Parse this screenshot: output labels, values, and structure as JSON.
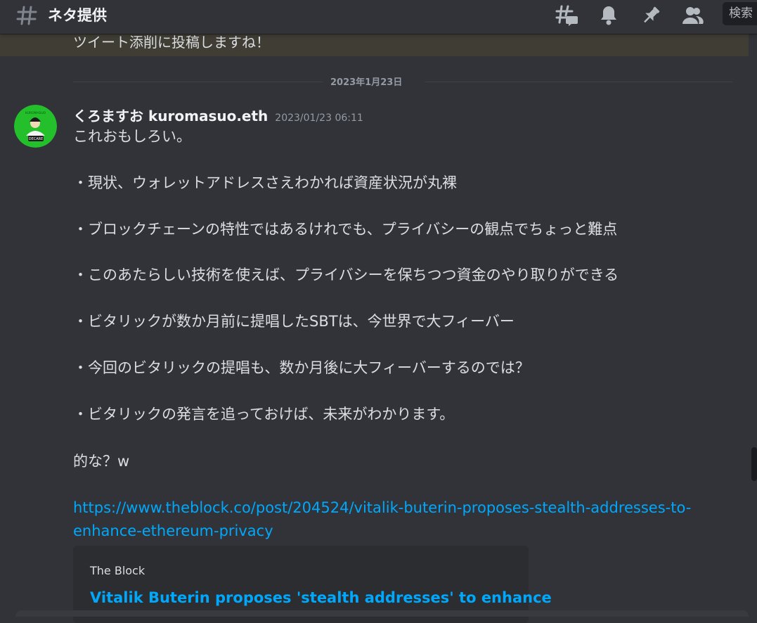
{
  "header": {
    "channel_icon": "hash-icon",
    "channel_name": "ネタ提供",
    "icons": [
      "threads-icon",
      "bell-icon",
      "pin-icon",
      "members-icon"
    ],
    "search_placeholder": "検索"
  },
  "previous_message": {
    "text": "ツイート添削に投稿しますね！",
    "highlight_color": "#403d35"
  },
  "date_divider": "2023年1月23日",
  "message": {
    "avatar_icon": "avatar-image",
    "author": "くろますお kuromasuo.eth",
    "timestamp": "2023/01/23 06:11",
    "lines": [
      "これおもしろい。",
      "・現状、ウォレットアドレスさえわかれば資産状況が丸裸",
      "・ブロックチェーンの特性ではあるけれでも、プライバシーの観点でちょっと難点",
      "・このあたらしい技術を使えば、プライバシーを保ちつつ資金のやり取りができる",
      "・ビタリックが数か月前に提唱したSBTは、今世界で大フィーバー",
      "・今回のビタリックの提唱も、数か月後に大フィーバーするのでは？",
      "・ビタリックの発言を追っておけば、未来がわかります。",
      "的な？w"
    ],
    "link_lines": [
      "https://www.theblock.co/post/204524/vitalik-buterin-proposes-stealth-addresses-to-",
      "enhance-ethereum-privacy"
    ],
    "link_color": "#00a8fc",
    "embed": {
      "provider": "The Block",
      "title": "Vitalik Buterin proposes 'stealth addresses' to enhance"
    }
  },
  "colors": {
    "background": "#313338",
    "text": "#dbdee1",
    "muted": "#949ba4",
    "avatar_green": "#23c02b"
  }
}
